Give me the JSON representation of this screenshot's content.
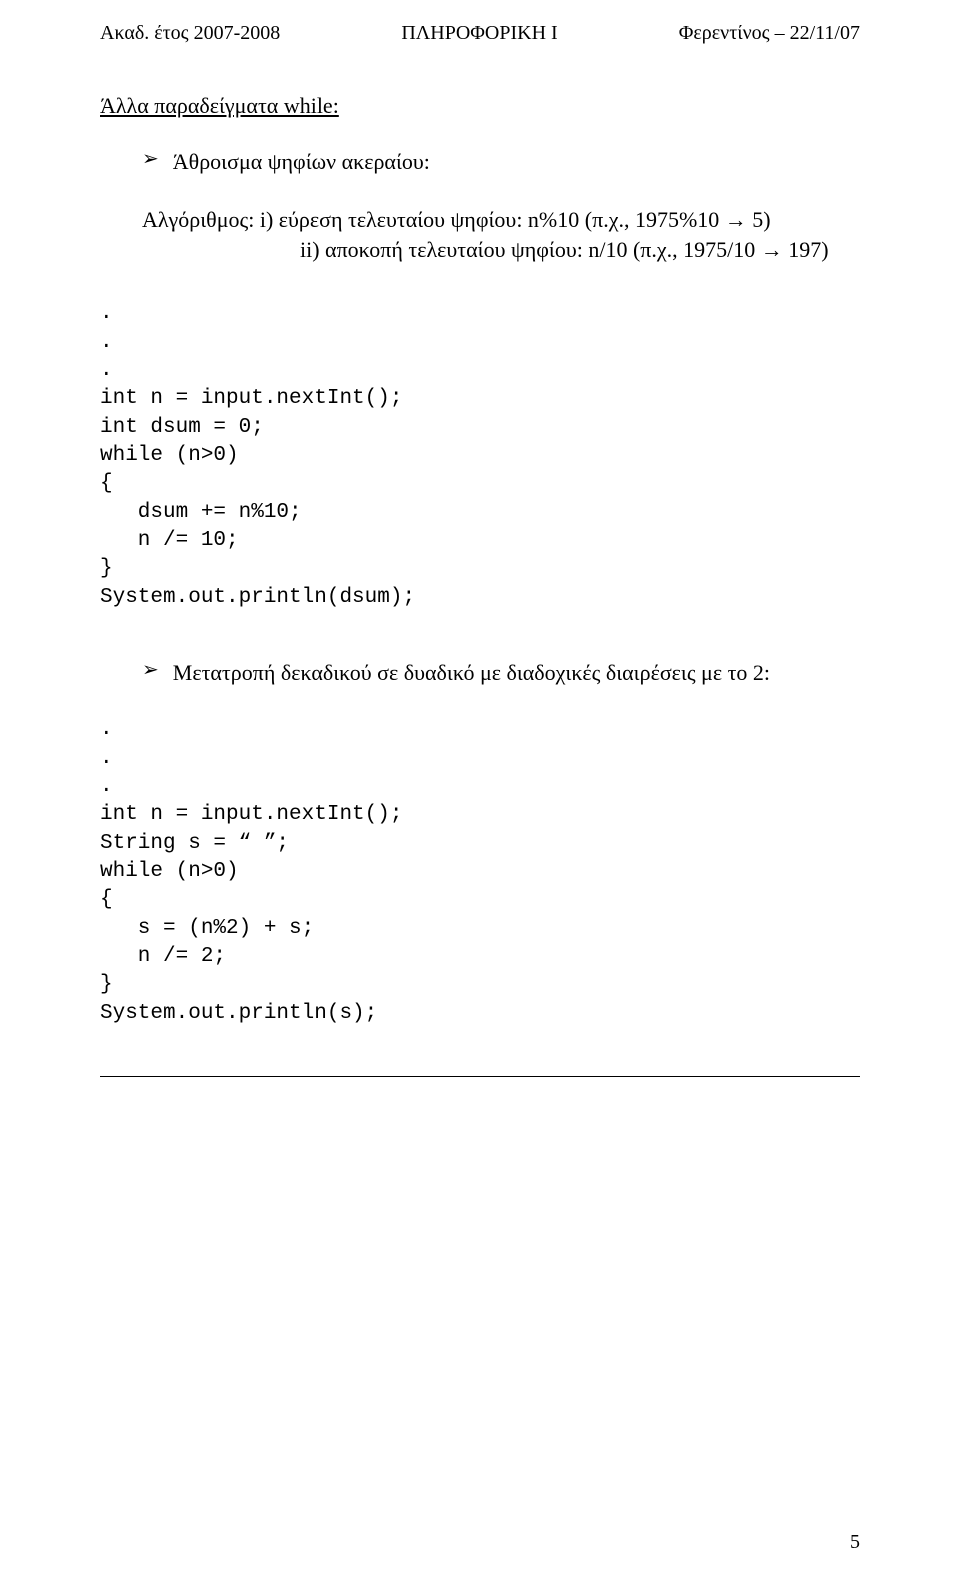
{
  "header": {
    "left": "Ακαδ. έτος 2007-2008",
    "center": "ΠΛΗΡΟΦΟΡΙΚΗ Ι",
    "right": "Φερεντίνος – 22/11/07"
  },
  "section_title": "Άλλα παραδείγματα while:",
  "bullet1": "Άθροισμα ψηφίων ακεραίου:",
  "algo": {
    "line1": "Αλγόριθμος: i) εύρεση τελευταίου ψηφίου: n%10 (π.χ., 1975%10 → 5)",
    "line2": "ii) αποκοπή τελευταίου ψηφίου: n/10 (π.χ., 1975/10 → 197)"
  },
  "code1": ".\n.\n.\nint n = input.nextInt();\nint dsum = 0;\nwhile (n>0)\n{\n   dsum += n%10;\n   n /= 10;\n}\nSystem.out.println(dsum);",
  "bullet2": "Μετατροπή δεκαδικού σε δυαδικό με διαδοχικές διαιρέσεις με το 2:",
  "code2": ".\n.\n.\nint n = input.nextInt();\nString s = “ ”;\nwhile (n>0)\n{\n   s = (n%2) + s;\n   n /= 2;\n}\nSystem.out.println(s);",
  "page_number": "5"
}
